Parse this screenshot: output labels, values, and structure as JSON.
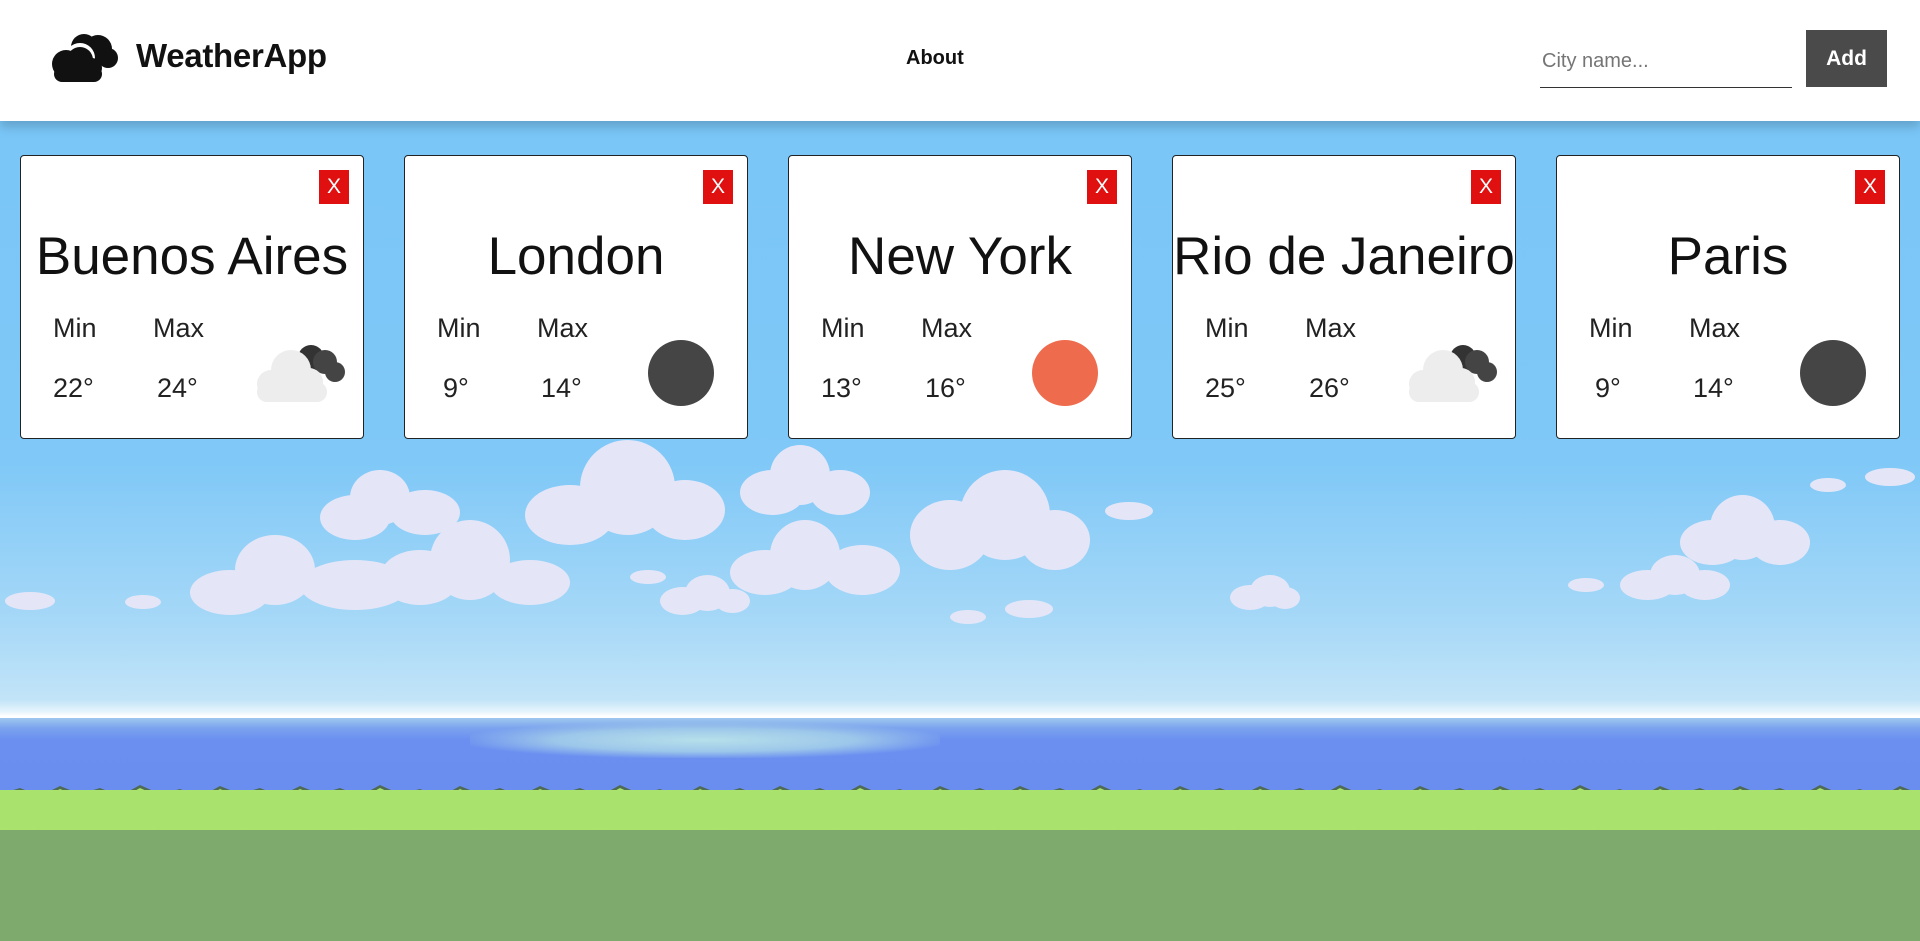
{
  "header": {
    "brand": "WeatherApp",
    "nav": {
      "about": "About"
    },
    "search": {
      "placeholder": "City name...",
      "value": ""
    },
    "add_label": "Add"
  },
  "cards": [
    {
      "city": "Buenos Aires",
      "min_label": "Min",
      "max_label": "Max",
      "min": "22°",
      "max": "24°",
      "icon": "cloudy-icon",
      "close": "X"
    },
    {
      "city": "London",
      "min_label": "Min",
      "max_label": "Max",
      "min": "9°",
      "max": "14°",
      "icon": "dark-circle-icon",
      "icon_color": "#454545",
      "close": "X"
    },
    {
      "city": "New York",
      "min_label": "Min",
      "max_label": "Max",
      "min": "13°",
      "max": "16°",
      "icon": "sun-icon",
      "icon_color": "#ee6c4d",
      "close": "X"
    },
    {
      "city": "Rio de Janeiro",
      "min_label": "Min",
      "max_label": "Max",
      "min": "25°",
      "max": "26°",
      "icon": "cloudy-icon",
      "close": "X"
    },
    {
      "city": "Paris",
      "min_label": "Min",
      "max_label": "Max",
      "min": "9°",
      "max": "14°",
      "icon": "dark-circle-icon",
      "icon_color": "#454545",
      "close": "X"
    }
  ],
  "colors": {
    "close_button": "#e01010",
    "add_button": "#4a4a4a",
    "sky": "#77c5f7",
    "grass": "#a9e26c",
    "ground": "#7faa6e"
  }
}
